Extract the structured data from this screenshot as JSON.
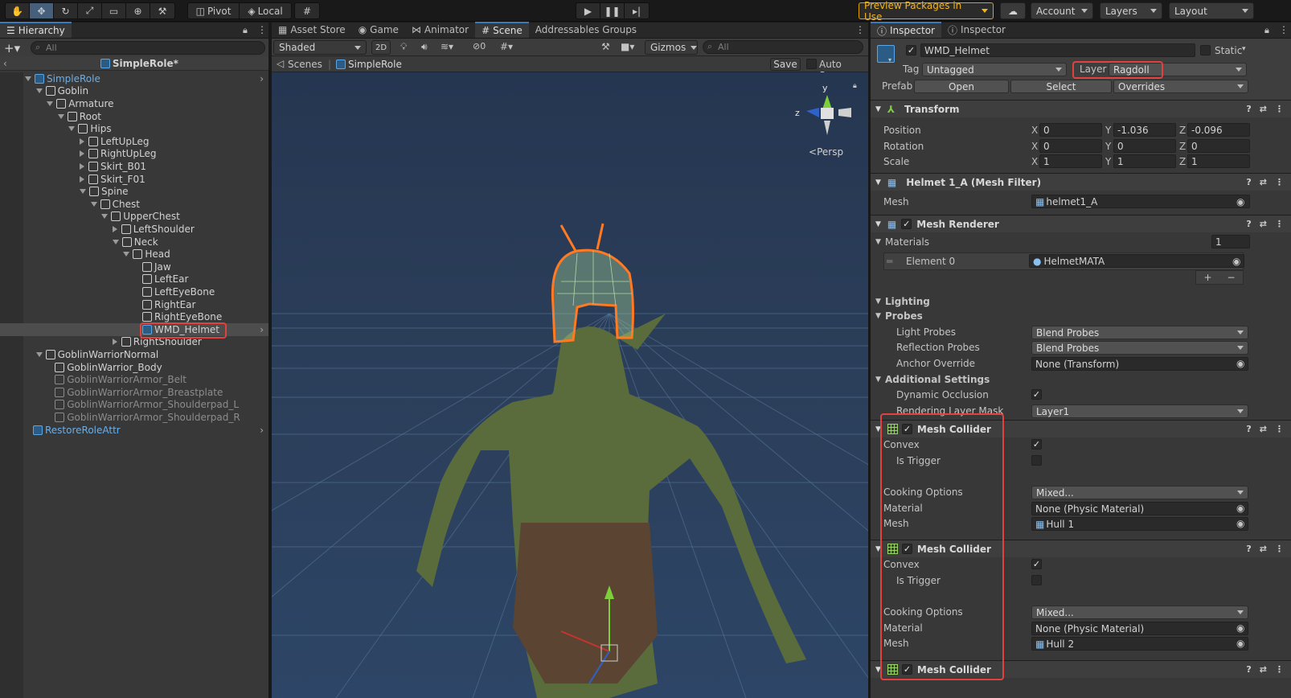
{
  "toolbar": {
    "pivot": "Pivot",
    "local": "Local",
    "preview_packages": "Preview Packages in Use",
    "account": "Account",
    "layers": "Layers",
    "layout": "Layout"
  },
  "hierarchy": {
    "tab": "Hierarchy",
    "search_placeholder": "All",
    "scene_name": "SimpleRole*",
    "items": [
      {
        "label": "SimpleRole"
      },
      {
        "label": "Goblin"
      },
      {
        "label": "Armature"
      },
      {
        "label": "Root"
      },
      {
        "label": "Hips"
      },
      {
        "label": "LeftUpLeg"
      },
      {
        "label": "RightUpLeg"
      },
      {
        "label": "Skirt_B01"
      },
      {
        "label": "Skirt_F01"
      },
      {
        "label": "Spine"
      },
      {
        "label": "Chest"
      },
      {
        "label": "UpperChest"
      },
      {
        "label": "LeftShoulder"
      },
      {
        "label": "Neck"
      },
      {
        "label": "Head"
      },
      {
        "label": "Jaw"
      },
      {
        "label": "LeftEar"
      },
      {
        "label": "LeftEyeBone"
      },
      {
        "label": "RightEar"
      },
      {
        "label": "RightEyeBone"
      },
      {
        "label": "WMD_Helmet"
      },
      {
        "label": "RightShoulder"
      },
      {
        "label": "GoblinWarriorNormal"
      },
      {
        "label": "GoblinWarrior_Body"
      },
      {
        "label": "GoblinWarriorArmor_Belt"
      },
      {
        "label": "GoblinWarriorArmor_Breastplate"
      },
      {
        "label": "GoblinWarriorArmor_Shoulderpad_L"
      },
      {
        "label": "GoblinWarriorArmor_Shoulderpad_R"
      },
      {
        "label": "RestoreRoleAttr"
      }
    ]
  },
  "scene": {
    "tabs": [
      "Asset Store",
      "Game",
      "Animator",
      "Scene",
      "Addressables Groups"
    ],
    "shading": "Shaded",
    "mode_2d": "2D",
    "hidden_count": "0",
    "gizmos": "Gizmos",
    "search_placeholder": "All",
    "breadcrumb_root": "Scenes",
    "breadcrumb_prefab": "SimpleRole",
    "save": "Save",
    "auto_save": "Auto Save",
    "persp": "Persp",
    "axis_y": "y",
    "axis_z": "z"
  },
  "inspector": {
    "tabs": [
      "Inspector",
      "Inspector"
    ],
    "object_name": "WMD_Helmet",
    "static_label": "Static",
    "tag_label": "Tag",
    "tag_value": "Untagged",
    "layer_label": "Layer",
    "layer_value": "Ragdoll",
    "prefab_label": "Prefab",
    "open": "Open",
    "select": "Select",
    "overrides": "Overrides",
    "transform": {
      "title": "Transform",
      "position_label": "Position",
      "rotation_label": "Rotation",
      "scale_label": "Scale",
      "position": [
        "0",
        "-1.036",
        "-0.096"
      ],
      "rotation": [
        "0",
        "0",
        "0"
      ],
      "scale": [
        "1",
        "1",
        "1"
      ]
    },
    "mesh_filter": {
      "title": "Helmet 1_A (Mesh Filter)",
      "mesh_label": "Mesh",
      "mesh_value": "helmet1_A"
    },
    "mesh_renderer": {
      "title": "Mesh Renderer",
      "materials_label": "Materials",
      "materials_count": "1",
      "element0_label": "Element 0",
      "element0_value": "HelmetMATA",
      "lighting": "Lighting",
      "probes": "Probes",
      "light_probes_label": "Light Probes",
      "light_probes_value": "Blend Probes",
      "reflection_probes_label": "Reflection Probes",
      "reflection_probes_value": "Blend Probes",
      "anchor_override_label": "Anchor Override",
      "anchor_override_value": "None (Transform)",
      "additional_settings": "Additional Settings",
      "dynamic_occlusion_label": "Dynamic Occlusion",
      "rendering_layer_mask_label": "Rendering Layer Mask",
      "rendering_layer_mask_value": "Layer1"
    },
    "mesh_colliders": [
      {
        "title": "Mesh Collider",
        "convex": "Convex",
        "is_trigger": "Is Trigger",
        "cooking_label": "Cooking Options",
        "cooking_value": "Mixed...",
        "material_label": "Material",
        "material_value": "None (Physic Material)",
        "mesh_label": "Mesh",
        "mesh_value": "Hull 1"
      },
      {
        "title": "Mesh Collider",
        "convex": "Convex",
        "is_trigger": "Is Trigger",
        "cooking_label": "Cooking Options",
        "cooking_value": "Mixed...",
        "material_label": "Material",
        "material_value": "None (Physic Material)",
        "mesh_label": "Mesh",
        "mesh_value": "Hull 2"
      },
      {
        "title": "Mesh Collider"
      }
    ]
  }
}
